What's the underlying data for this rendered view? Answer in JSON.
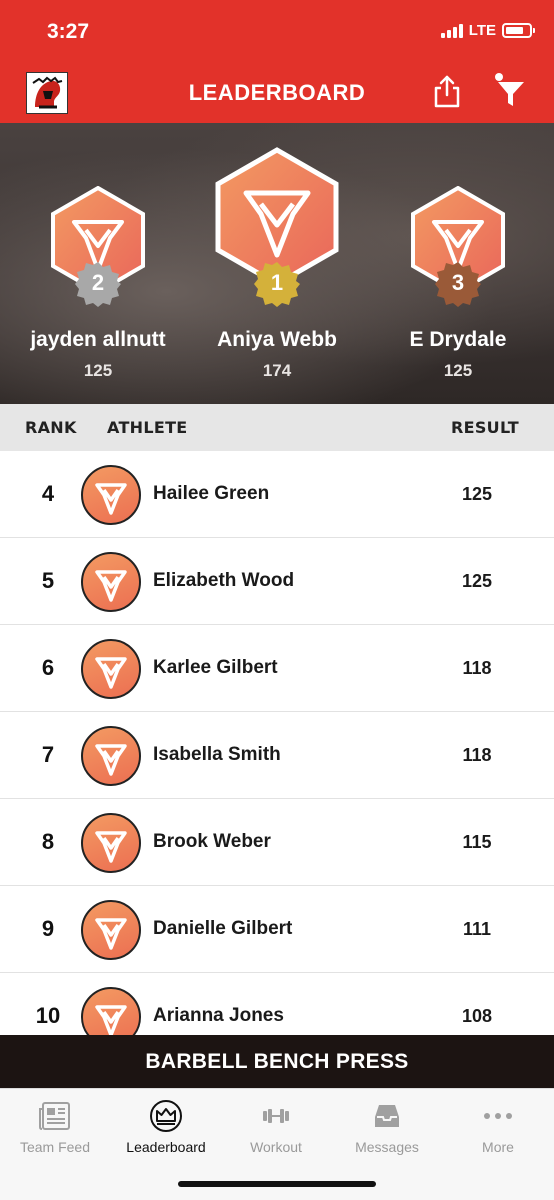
{
  "status": {
    "time": "3:27",
    "network": "LTE"
  },
  "nav": {
    "title": "LEADERBOARD"
  },
  "podium": [
    {
      "place": "2",
      "name": "jayden allnutt",
      "score": "125",
      "medal_color": "#a8a8a8"
    },
    {
      "place": "1",
      "name": "Aniya Webb",
      "score": "174",
      "medal_color": "#d4b13a"
    },
    {
      "place": "3",
      "name": "E Drydale",
      "score": "125",
      "medal_color": "#9a5a38"
    }
  ],
  "columns": {
    "rank": "RANK",
    "athlete": "ATHLETE",
    "result": "RESULT"
  },
  "rows": [
    {
      "rank": "4",
      "name": "Hailee Green",
      "result": "125"
    },
    {
      "rank": "5",
      "name": "Elizabeth Wood",
      "result": "125"
    },
    {
      "rank": "6",
      "name": "Karlee Gilbert",
      "result": "118"
    },
    {
      "rank": "7",
      "name": "Isabella Smith",
      "result": "118"
    },
    {
      "rank": "8",
      "name": "Brook Weber",
      "result": "115"
    },
    {
      "rank": "9",
      "name": "Danielle Gilbert",
      "result": "111"
    },
    {
      "rank": "10",
      "name": "Arianna Jones",
      "result": "108"
    }
  ],
  "exercise": {
    "name": "BARBELL BENCH PRESS"
  },
  "tabs": [
    {
      "label": "Team Feed",
      "icon": "newspaper-icon",
      "active": false
    },
    {
      "label": "Leaderboard",
      "icon": "crown-icon",
      "active": true
    },
    {
      "label": "Workout",
      "icon": "dumbbell-icon",
      "active": false
    },
    {
      "label": "Messages",
      "icon": "inbox-icon",
      "active": false
    },
    {
      "label": "More",
      "icon": "more-dots-icon",
      "active": false
    }
  ],
  "colors": {
    "header_red": "#e2322a",
    "avatar_orange": "#f0845a",
    "banner_dark": "#1c1412"
  }
}
